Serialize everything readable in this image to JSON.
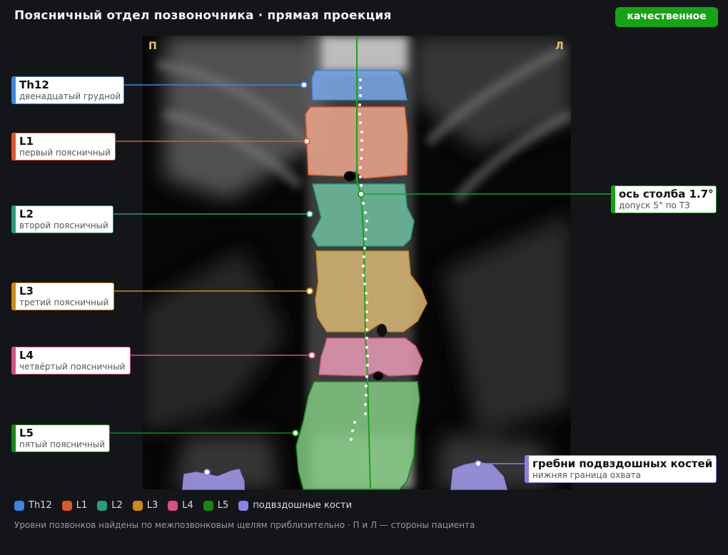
{
  "header": {
    "title": "Поясничный отдел позвоночника · прямая проекция",
    "badge": "качественное"
  },
  "scan": {
    "side_right_patient": "П",
    "side_left_patient": "Л"
  },
  "vertebrae": [
    {
      "name": "Th12",
      "desc": "двенадцатый грудной",
      "color": "#3b86e0"
    },
    {
      "name": "L1",
      "desc": "первый поясничный",
      "color": "#e0582a"
    },
    {
      "name": "L2",
      "desc": "второй поясничный",
      "color": "#21a07a"
    },
    {
      "name": "L3",
      "desc": "третий поясничный",
      "color": "#cf8a10"
    },
    {
      "name": "L4",
      "desc": "четвёртый поясничный",
      "color": "#d9507e"
    },
    {
      "name": "L5",
      "desc": "пятый поясничный",
      "color": "#138a13"
    }
  ],
  "axis_callout": {
    "name": "ось столба 1.7°",
    "desc": "допуск 5° по ТЗ",
    "color": "#16a316"
  },
  "iliac_callout": {
    "name": "гребни подвздошных костей",
    "desc": "нижняя граница охвата",
    "color": "#8b80e6"
  },
  "legend": [
    {
      "label": "Th12",
      "color": "#3b86e0"
    },
    {
      "label": "L1",
      "color": "#e0582a"
    },
    {
      "label": "L2",
      "color": "#21a07a"
    },
    {
      "label": "L3",
      "color": "#cf8a10"
    },
    {
      "label": "L4",
      "color": "#d9507e"
    },
    {
      "label": "L5",
      "color": "#138a13"
    },
    {
      "label": "подвздошные кости",
      "color": "#8b80e6"
    }
  ],
  "footnote": "Уровни позвонков найдены по межпозвонковым щелям приблизительно · П и Л — стороны пациента"
}
